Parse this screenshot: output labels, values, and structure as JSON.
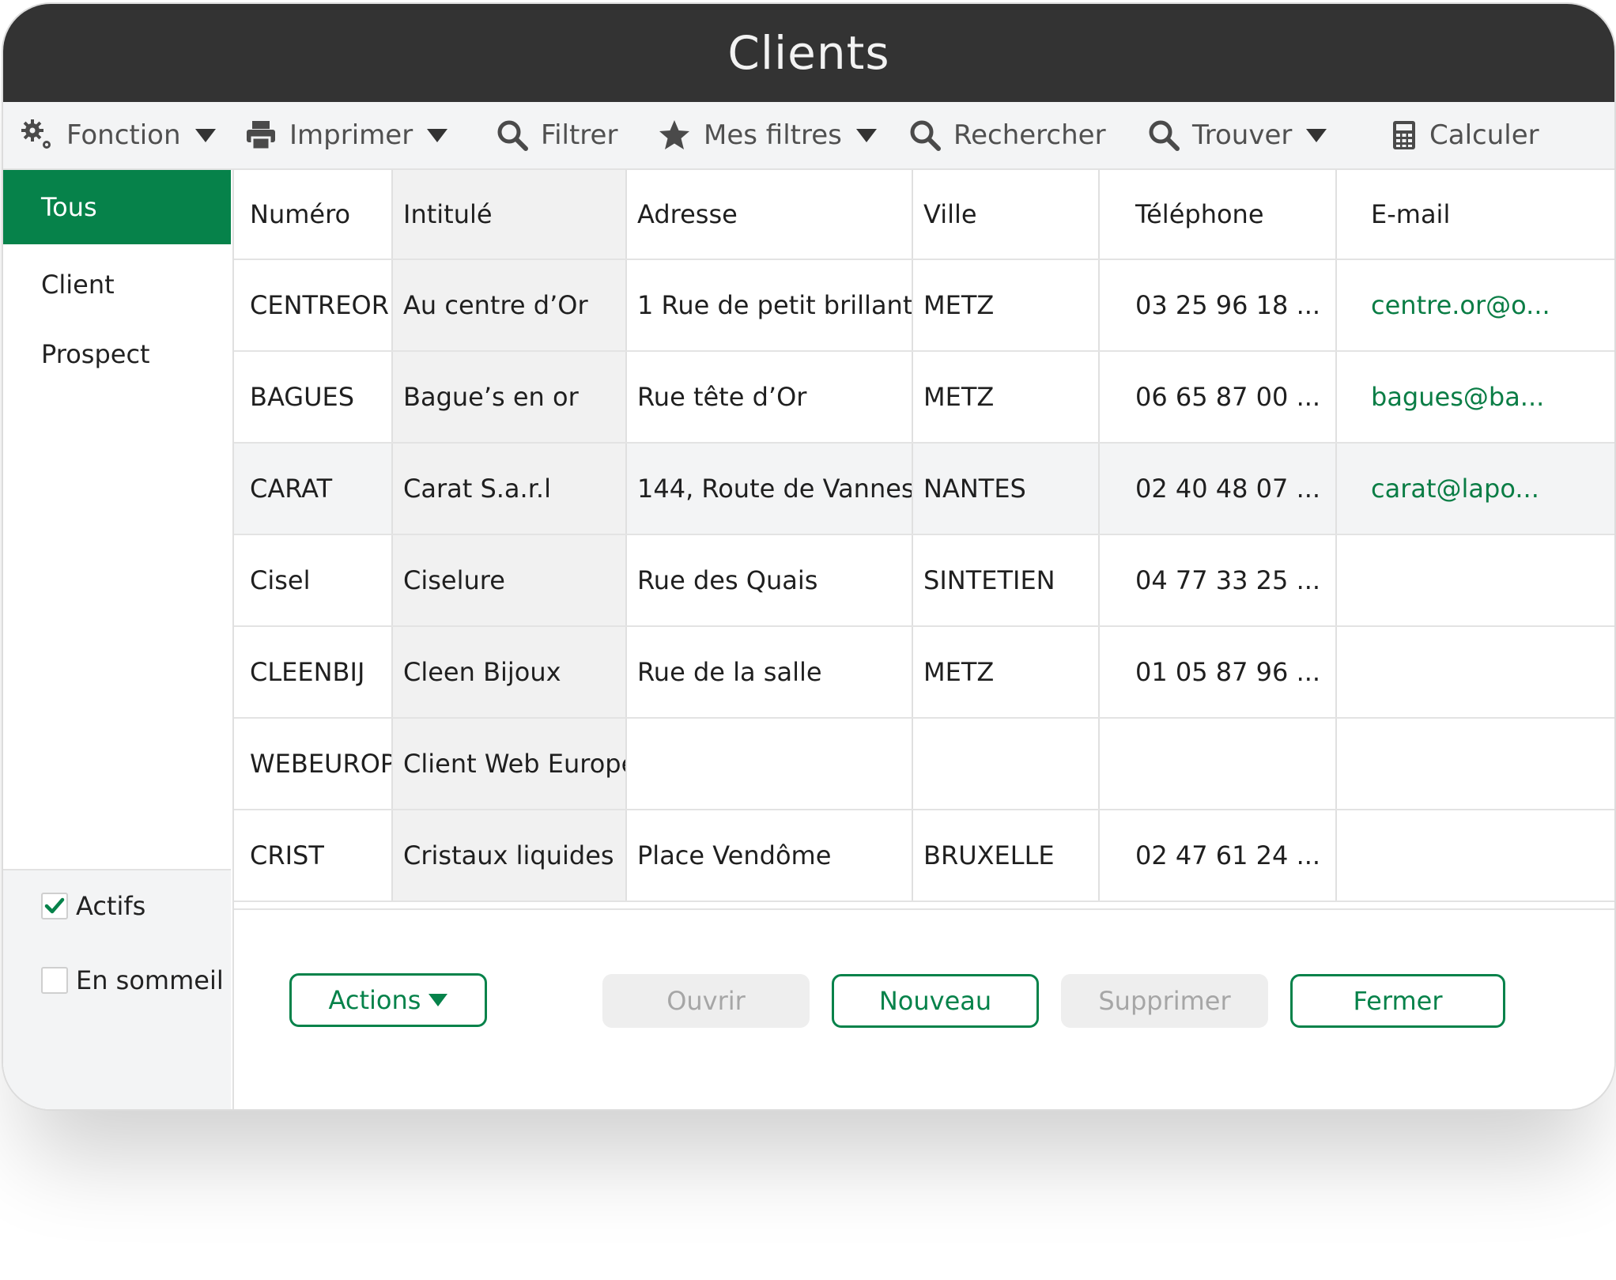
{
  "window": {
    "title": "Clients"
  },
  "toolbar": {
    "fonction": "Fonction",
    "imprimer": "Imprimer",
    "filtrer": "Filtrer",
    "mes_filtres": "Mes filtres",
    "rechercher": "Rechercher",
    "trouver": "Trouver",
    "calculer": "Calculer"
  },
  "sidebar": {
    "items": [
      "Tous",
      "Client",
      "Prospect"
    ],
    "filters": {
      "actifs": "Actifs",
      "actifs_checked": true,
      "en_sommeil": "En sommeil",
      "en_sommeil_checked": false
    }
  },
  "table": {
    "columns": [
      "Numéro",
      "Intitulé",
      "Adresse",
      "Ville",
      "Téléphone",
      "E-mail"
    ],
    "rows": [
      [
        "CENTREOR",
        "Au centre d’Or",
        "1 Rue de petit brillant",
        "METZ",
        "03 25 96 18 ...",
        "centre.or@o..."
      ],
      [
        "BAGUES",
        "Bague’s en or",
        "Rue tête d’Or",
        "METZ",
        "06 65 87 00 ...",
        "bagues@ba..."
      ],
      [
        "CARAT",
        "Carat S.a.r.l",
        "144, Route de Vannes",
        "NANTES",
        "02 40 48 07 ...",
        "carat@lapo..."
      ],
      [
        "Cisel",
        "Ciselure",
        "Rue des Quais",
        "SINTETIEN",
        "04 77 33 25 ...",
        ""
      ],
      [
        "CLEENBIJ",
        "Cleen Bijoux",
        "Rue de la salle",
        "METZ",
        "01 05 87 96 ...",
        ""
      ],
      [
        "WEBEUROPE",
        "Client Web Europe",
        "",
        "",
        "",
        ""
      ],
      [
        "CRIST",
        "Cristaux liquides",
        "Place Vendôme",
        "BRUXELLE",
        "02 47 61 24 ...",
        ""
      ]
    ],
    "selected_row": 2
  },
  "footer": {
    "actions": "Actions",
    "ouvrir": "Ouvrir",
    "nouveau": "Nouveau",
    "supprimer": "Supprimer",
    "fermer": "Fermer"
  },
  "colors": {
    "accent": "#06824a",
    "titlebar": "#333333",
    "email": "#0a7d45"
  }
}
